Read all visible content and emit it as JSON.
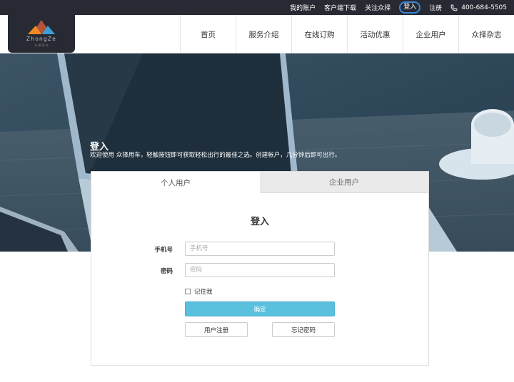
{
  "topbar": {
    "my_account": "我的账户",
    "app_download": "客户端下载",
    "follow": "关注众择",
    "login": "登入",
    "register": "注册",
    "phone": "400-684-5505"
  },
  "logo": {
    "text": "ZhongZe",
    "subtext": "众 择 用 车"
  },
  "nav": {
    "items": [
      {
        "label": "首页"
      },
      {
        "label": "服务介绍"
      },
      {
        "label": "在线订购"
      },
      {
        "label": "活动优惠"
      },
      {
        "label": "企业用户"
      },
      {
        "label": "众择杂志"
      }
    ]
  },
  "hero": {
    "title": "登入",
    "subtitle": "欢迎使用 众择用车，轻触按钮即可获取轻松出行的最佳之选。创建帐户，几分钟后即可出行。"
  },
  "login_form": {
    "tabs": [
      {
        "label": "个人用户",
        "active": true
      },
      {
        "label": "企业用户",
        "active": false
      }
    ],
    "title": "登入",
    "phone_label": "手机号",
    "phone_placeholder": "手机号",
    "password_label": "密码",
    "password_placeholder": "密码",
    "remember_label": "记住我",
    "confirm_label": "确定",
    "register_label": "用户注册",
    "forgot_label": "忘记密码"
  },
  "colors": {
    "topbar_bg": "#272a33",
    "accent_blue": "#5bc0de",
    "login_highlight": "#3b86d8",
    "logo_orange": "#f08a24",
    "logo_blue": "#3aa0d8"
  }
}
